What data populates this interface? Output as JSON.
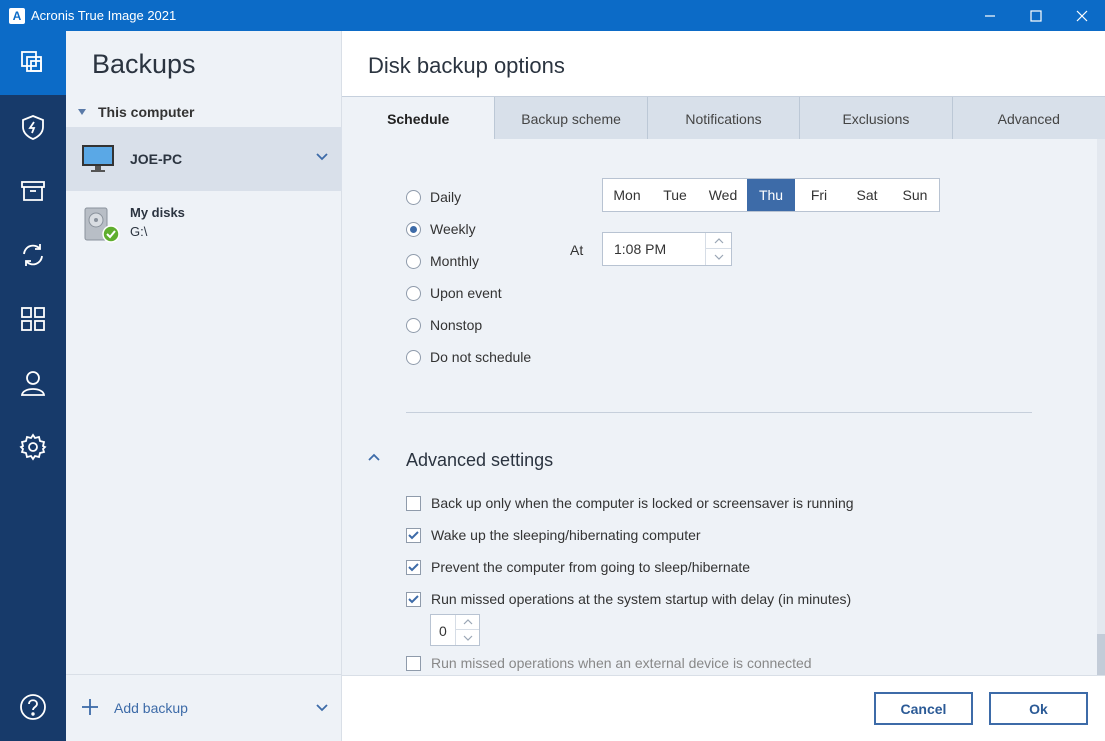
{
  "window": {
    "logo_letter": "A",
    "title": "Acronis True Image 2021"
  },
  "leftnav": {
    "items": [
      {
        "name": "backup-icon",
        "active": true
      },
      {
        "name": "protection-icon"
      },
      {
        "name": "archive-icon"
      },
      {
        "name": "sync-icon"
      },
      {
        "name": "tools-icon"
      },
      {
        "name": "account-icon"
      },
      {
        "name": "settings-icon"
      },
      {
        "name": "help-icon"
      }
    ]
  },
  "backups": {
    "heading": "Backups",
    "group_label": "This computer",
    "computer_name": "JOE-PC",
    "disk_name": "My disks",
    "disk_path": "G:\\",
    "add_label": "Add backup"
  },
  "main": {
    "title": "Disk backup options",
    "tabs": [
      {
        "label": "Schedule",
        "active": true
      },
      {
        "label": "Backup scheme"
      },
      {
        "label": "Notifications"
      },
      {
        "label": "Exclusions"
      },
      {
        "label": "Advanced"
      }
    ]
  },
  "schedule": {
    "options": [
      {
        "label": "Daily",
        "selected": false
      },
      {
        "label": "Weekly",
        "selected": true
      },
      {
        "label": "Monthly",
        "selected": false
      },
      {
        "label": "Upon event",
        "selected": false
      },
      {
        "label": "Nonstop",
        "selected": false
      },
      {
        "label": "Do not schedule",
        "selected": false
      }
    ],
    "days": [
      "Mon",
      "Tue",
      "Wed",
      "Thu",
      "Fri",
      "Sat",
      "Sun"
    ],
    "selected_day": "Thu",
    "at_label": "At",
    "time_value": "1:08 PM"
  },
  "advanced": {
    "heading": "Advanced settings",
    "options": [
      {
        "label": "Back up only when the computer is locked or screensaver is running",
        "checked": false
      },
      {
        "label": "Wake up the sleeping/hibernating computer",
        "checked": true
      },
      {
        "label": "Prevent the computer from going to sleep/hibernate",
        "checked": true
      },
      {
        "label": "Run missed operations at the system startup with delay (in minutes)",
        "checked": true
      },
      {
        "label": "Run missed operations when an external device is connected",
        "checked": false
      }
    ],
    "delay_value": "0"
  },
  "footer": {
    "cancel_label": "Cancel",
    "ok_label": "Ok"
  },
  "colors": {
    "titlebar": "#0c6bc7",
    "nav_bg": "#173a6a",
    "accent": "#3d6ba8"
  }
}
